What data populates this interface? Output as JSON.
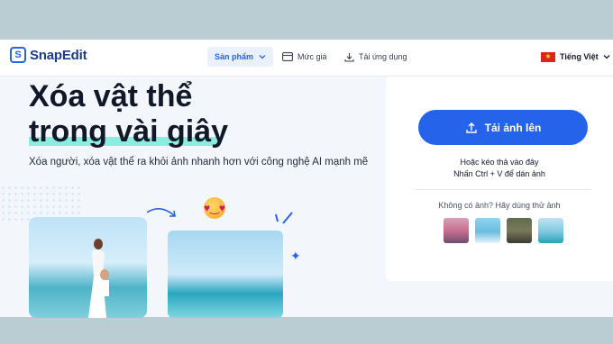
{
  "brand": {
    "name": "SnapEdit"
  },
  "nav": {
    "products": "Sản phẩm",
    "pricing": "Mức giá",
    "download_app": "Tải ứng dụng"
  },
  "language": {
    "label": "Tiếng Việt"
  },
  "hero": {
    "title_line1": "Xóa vật thể",
    "title_line2": "trong vài giây",
    "subtitle": "Xóa người, xóa vật thể ra khỏi ảnh nhanh hơn với công nghệ AI mạnh mẽ"
  },
  "upload": {
    "button_label": "Tải ảnh lên",
    "drop_hint_1": "Hoặc kéo thả vào đây",
    "drop_hint_2": "Nhấn Ctrl + V để dán ảnh",
    "sample_prompt": "Không có ảnh? Hãy dùng thử ảnh"
  },
  "icons": {
    "logo": "snapedit-logo-icon",
    "products_chevron": "chevron-down-icon",
    "pricing": "credit-card-icon",
    "download": "download-icon",
    "language_flag": "vietnam-flag-icon",
    "language_chevron": "chevron-down-icon",
    "upload": "upload-icon",
    "emoji": "heart-eyes-emoji-icon",
    "star": "sparkle-star-icon"
  },
  "colors": {
    "accent": "#2563eb",
    "highlight": "#5eead4",
    "background": "#f3f6fb"
  }
}
